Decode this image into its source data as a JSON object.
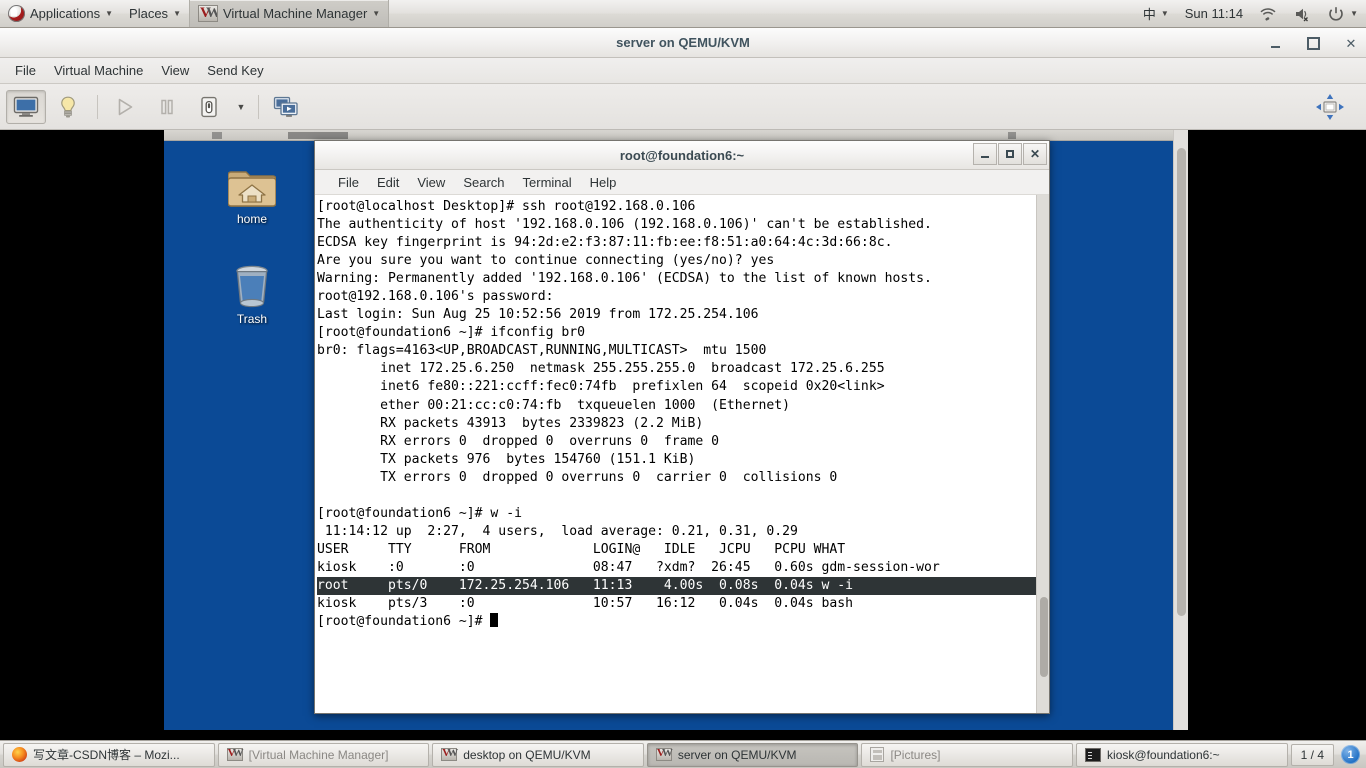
{
  "gnome_panel": {
    "applications_label": "Applications",
    "places_label": "Places",
    "active_app_label": "Virtual Machine Manager",
    "input_method": "中",
    "clock": "Sun 11:14",
    "icons": {
      "fedora": "fedora-logo-icon",
      "caret": "chevron-down-icon",
      "wifi": "wifi-icon",
      "volume": "volume-muted-icon",
      "power": "power-icon"
    }
  },
  "vmm_window": {
    "title": "server on QEMU/KVM",
    "menus": [
      "File",
      "Virtual Machine",
      "View",
      "Send Key"
    ],
    "toolbar": {
      "show_console_label": "Show the graphical console",
      "show_details_label": "Show virtual hardware details",
      "run_label": "Run",
      "pause_label": "Pause",
      "shutdown_label": "Shut Down",
      "shutdown_caret_label": "Shutdown options",
      "snapshots_label": "Manage VM snapshots",
      "fullscreen_label": "Fullscreen"
    },
    "window_controls": {
      "minimize": "minimize-icon",
      "maximize": "maximize-icon",
      "close": "close-icon"
    }
  },
  "vm_desktop": {
    "icons": [
      {
        "name": "home",
        "label": "home"
      },
      {
        "name": "trash",
        "label": "Trash"
      }
    ]
  },
  "terminal": {
    "title": "root@foundation6:~",
    "menus": [
      "File",
      "Edit",
      "View",
      "Search",
      "Terminal",
      "Help"
    ],
    "window_controls": {
      "minimize": "minimize-icon",
      "maximize": "maximize-icon",
      "close": "close-icon"
    },
    "lines_before": "[root@localhost Desktop]# ssh root@192.168.0.106\nThe authenticity of host '192.168.0.106 (192.168.0.106)' can't be established.\nECDSA key fingerprint is 94:2d:e2:f3:87:11:fb:ee:f8:51:a0:64:4c:3d:66:8c.\nAre you sure you want to continue connecting (yes/no)? yes\nWarning: Permanently added '192.168.0.106' (ECDSA) to the list of known hosts.\nroot@192.168.0.106's password:\nLast login: Sun Aug 25 10:52:56 2019 from 172.25.254.106\n[root@foundation6 ~]# ifconfig br0\nbr0: flags=4163<UP,BROADCAST,RUNNING,MULTICAST>  mtu 1500\n        inet 172.25.6.250  netmask 255.255.255.0  broadcast 172.25.6.255\n        inet6 fe80::221:ccff:fec0:74fb  prefixlen 64  scopeid 0x20<link>\n        ether 00:21:cc:c0:74:fb  txqueuelen 1000  (Ethernet)\n        RX packets 43913  bytes 2339823 (2.2 MiB)\n        RX errors 0  dropped 0  overruns 0  frame 0\n        TX packets 976  bytes 154760 (151.1 KiB)\n        TX errors 0  dropped 0 overruns 0  carrier 0  collisions 0\n\n[root@foundation6 ~]# w -i\n 11:14:12 up  2:27,  4 users,  load average: 0.21, 0.31, 0.29\nUSER     TTY      FROM             LOGIN@   IDLE   JCPU   PCPU WHAT\nkiosk    :0       :0               08:47   ?xdm?  26:45   0.60s gdm-session-wor",
    "highlighted_line": "root     pts/0    172.25.254.106   11:13    4.00s  0.08s  0.04s w -i",
    "lines_after": "kiosk    pts/3    :0               10:57   16:12   0.04s  0.04s bash",
    "prompt": "[root@foundation6 ~]# "
  },
  "taskbar": {
    "items": [
      {
        "label": "写文章-CSDN博客 – Mozi...",
        "icon": "firefox-icon",
        "state": "normal"
      },
      {
        "label": "[Virtual Machine Manager]",
        "icon": "vmm-icon",
        "state": "minimized"
      },
      {
        "label": "desktop on QEMU/KVM",
        "icon": "vmm-icon",
        "state": "normal"
      },
      {
        "label": "server on QEMU/KVM",
        "icon": "vmm-icon",
        "state": "active"
      },
      {
        "label": "[Pictures]",
        "icon": "folder-icon",
        "state": "minimized"
      },
      {
        "label": "kiosk@foundation6:~",
        "icon": "terminal-icon",
        "state": "normal"
      }
    ],
    "workspace_label": "1 / 4",
    "workspace_badge": "1"
  },
  "colors": {
    "vm_desktop_bg": "#0b4a96",
    "terminal_fg": "#000000",
    "terminal_bg": "#ffffff",
    "terminal_highlight_bg": "#2e3436",
    "panel_bg": "#dcdad5"
  }
}
